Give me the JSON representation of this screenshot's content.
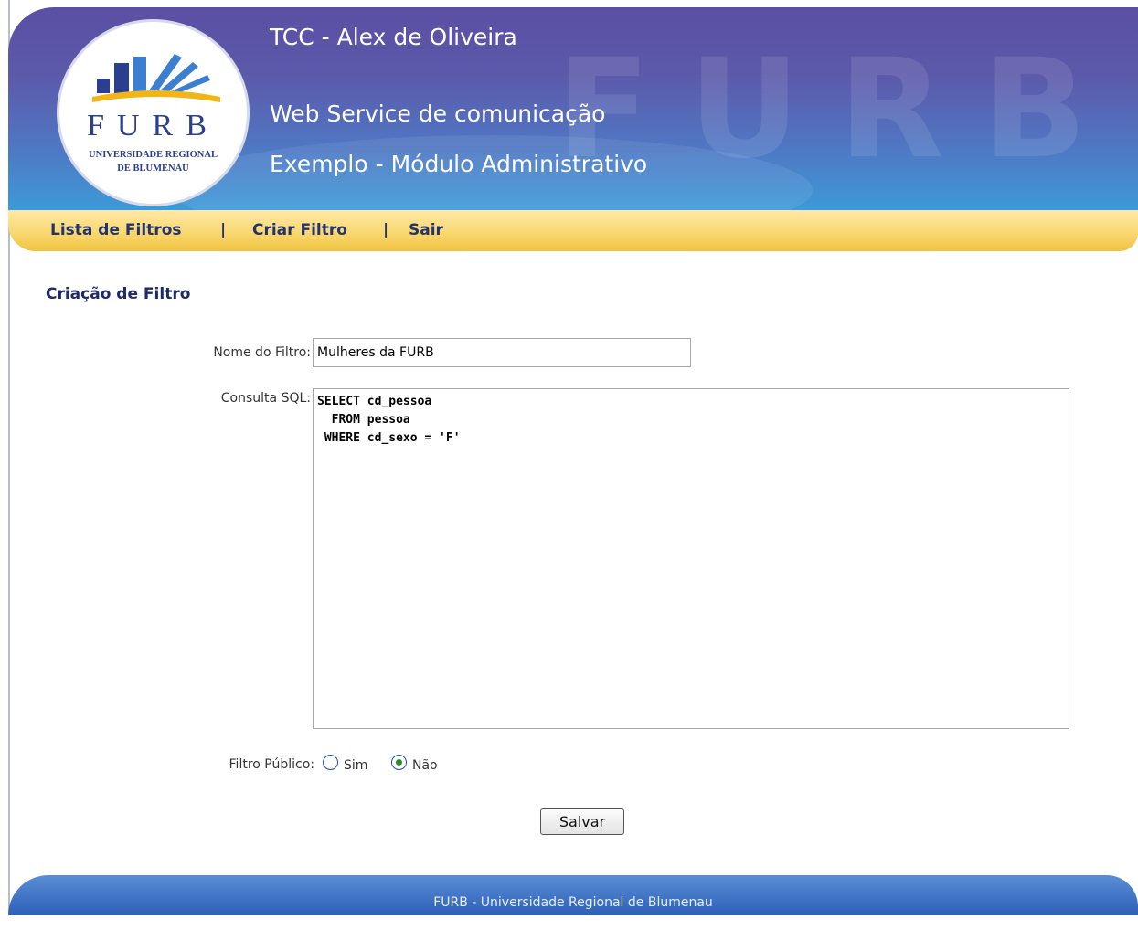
{
  "header": {
    "title": "TCC - Alex de Oliveira",
    "subtitle": "Web Service de comunicação",
    "subtitle2": "Exemplo - Módulo Administrativo",
    "logo": {
      "word": "FURB",
      "line1": "UNIVERSIDADE REGIONAL",
      "line2": "DE BLUMENAU"
    },
    "watermark": "FURB"
  },
  "nav": {
    "items": [
      {
        "label": "Lista de Filtros"
      },
      {
        "label": "Criar Filtro"
      },
      {
        "label": "Sair"
      }
    ],
    "separator": "|"
  },
  "page": {
    "heading": "Criação de Filtro"
  },
  "form": {
    "name_label": "Nome do Filtro:",
    "name_value": "Mulheres da FURB",
    "sql_label": "Consulta SQL:",
    "sql_value": "SELECT cd_pessoa\n  FROM pessoa\n WHERE cd_sexo = 'F'",
    "public_label": "Filtro Público:",
    "options": [
      {
        "label": "Sim",
        "checked": false
      },
      {
        "label": "Não",
        "checked": true
      }
    ],
    "save_label": "Salvar"
  },
  "footer": {
    "text": "FURB - Universidade Regional de Blumenau"
  },
  "colors": {
    "header_top": "#5a4fa3",
    "header_bottom": "#3d9ad8",
    "nav_yellow": "#f9d870",
    "nav_text": "#24336e",
    "radio_check": "#2f8b22",
    "footer_blue": "#2d5fb8"
  }
}
